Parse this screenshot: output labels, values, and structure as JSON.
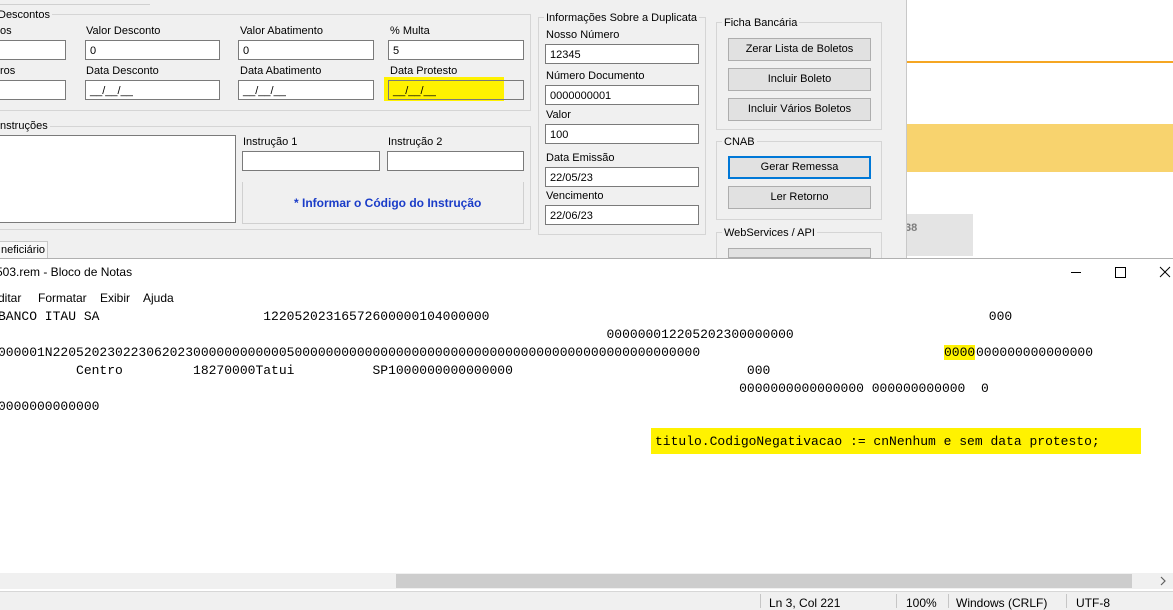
{
  "form": {
    "descontos": {
      "title": "Descontos",
      "col1_label_top": "os",
      "col1_label_bottom": "ros",
      "valor_desconto_label": "Valor Desconto",
      "valor_desconto_value": "0",
      "valor_abatimento_label": "Valor Abatimento",
      "valor_abatimento_value": "0",
      "multa_label": "% Multa",
      "multa_value": "5",
      "data_desconto_label": "Data Desconto",
      "data_desconto_value": "__/__/__",
      "data_abatimento_label": "Data Abatimento",
      "data_abatimento_value": "__/__/__",
      "data_protesto_label": "Data Protesto",
      "data_protesto_value": "__/__/__"
    },
    "instrucoes": {
      "title": "nstruções",
      "instrucao1_label": "Instrução 1",
      "instrucao2_label": "Instrução 2",
      "info_text": "* Informar o Código do Instrução"
    },
    "beneficiario_tab": "neficiário",
    "duplicata": {
      "title": "Informações Sobre a Duplicata",
      "nosso_numero_label": "Nosso Número",
      "nosso_numero_value": "12345",
      "numero_documento_label": "Número Documento",
      "numero_documento_value": "0000000001",
      "valor_label": "Valor",
      "valor_value": "100",
      "data_emissao_label": "Data Emissão",
      "data_emissao_value": "22/05/23",
      "vencimento_label": "Vencimento",
      "vencimento_value": "22/06/23"
    },
    "ficha": {
      "title": "Ficha Bancária",
      "btn_zerar": "Zerar Lista de Boletos",
      "btn_incluir": "Incluir Boleto",
      "btn_incluir_varios": "Incluir Vários Boletos"
    },
    "cnab": {
      "title": "CNAB",
      "btn_gerar": "Gerar Remessa",
      "btn_ler": "Ler Retorno"
    },
    "webservices": {
      "title": "WebServices / API"
    }
  },
  "background_app": {
    "partial_text": "38"
  },
  "notepad": {
    "title": "503.rem - Bloco de Notas",
    "menu": [
      "ditar",
      "Formatar",
      "Exibir",
      "Ajuda"
    ],
    "lines": [
      "BANCO ITAU SA                     12205202316572600000104000000                                                                000",
      "                                                                              000000012205202300000000",
      "000001N22052023022306202300000000000050000000000000000000000000000000000000000000000000000",
      "          Centro         18270000Tatui          SP1000000000000000                              000",
      "                                                                                               0000000000000000 000000000000  0",
      "0000000000000"
    ],
    "line3_highlight": "0000",
    "line3_after": "000000000000000",
    "comment": "titulo.CodigoNegativacao := cnNenhum e sem data protesto;",
    "status": {
      "position": "Ln 3, Col 221",
      "zoom": "100%",
      "eol": "Windows (CRLF)",
      "encoding": "UTF-8"
    }
  },
  "colors": {
    "highlight": "#fff200",
    "banner": "#f8d36e",
    "orange_line": "#f5a623",
    "link_blue": "#1a3cc8"
  }
}
